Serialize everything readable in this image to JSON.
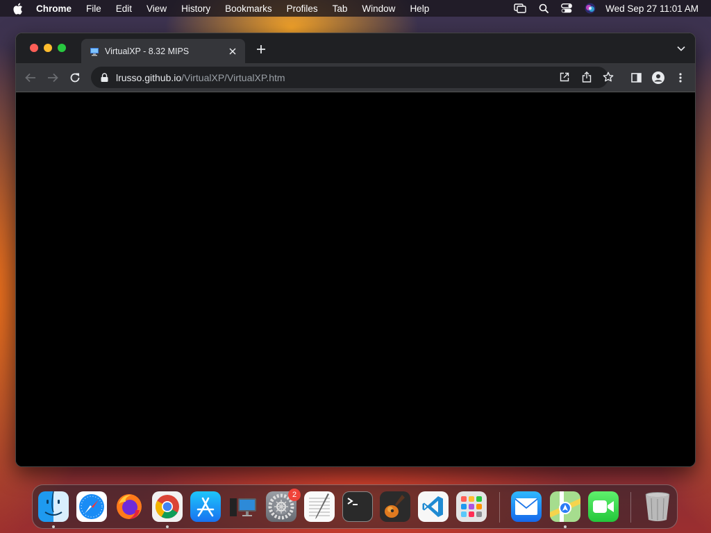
{
  "menubar": {
    "app_name": "Chrome",
    "items": [
      "File",
      "Edit",
      "View",
      "History",
      "Bookmarks",
      "Profiles",
      "Tab",
      "Window",
      "Help"
    ],
    "clock": "Wed Sep 27  11:01 AM"
  },
  "browser": {
    "tab_title": "VirtualXP - 8.32 MIPS",
    "url_host": "lrusso.github.io",
    "url_path": "/VirtualXP/VirtualXP.htm",
    "page_background": "#000000"
  },
  "dock": {
    "apps": [
      {
        "name": "Finder",
        "running": true
      },
      {
        "name": "Safari",
        "running": false
      },
      {
        "name": "Firefox",
        "running": false
      },
      {
        "name": "Google Chrome",
        "running": true
      },
      {
        "name": "App Store",
        "running": false
      },
      {
        "name": "Remote Desktop",
        "running": false
      },
      {
        "name": "System Settings",
        "running": false
      },
      {
        "name": "TextEdit",
        "running": false
      },
      {
        "name": "Terminal",
        "running": false
      },
      {
        "name": "GarageBand",
        "running": false
      },
      {
        "name": "Visual Studio Code",
        "running": false
      },
      {
        "name": "Launchpad",
        "running": false
      },
      {
        "name": "Mail",
        "running": false
      },
      {
        "name": "Maps",
        "running": true
      },
      {
        "name": "FaceTime",
        "running": false
      },
      {
        "name": "Trash",
        "running": false
      }
    ],
    "settings_badge": "2"
  }
}
